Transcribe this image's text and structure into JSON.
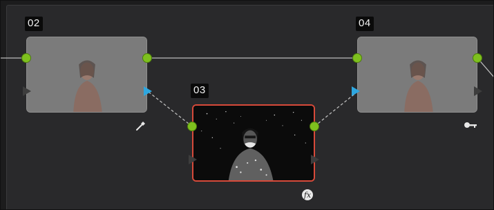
{
  "nodes": [
    {
      "id": "node-02",
      "label": "02",
      "type": "serial",
      "selected": false
    },
    {
      "id": "node-03",
      "label": "03",
      "type": "parallel",
      "selected": true
    },
    {
      "id": "node-04",
      "label": "04",
      "type": "serial",
      "selected": false
    }
  ],
  "icons": {
    "node02_badge": "eyedropper-icon",
    "node03_badge": "fx-icon",
    "node04_badge": "key-icon"
  },
  "colors": {
    "input_dot": "#7ec01e",
    "key_input": "#2ea7e0",
    "selected_border": "#d84a3a"
  }
}
